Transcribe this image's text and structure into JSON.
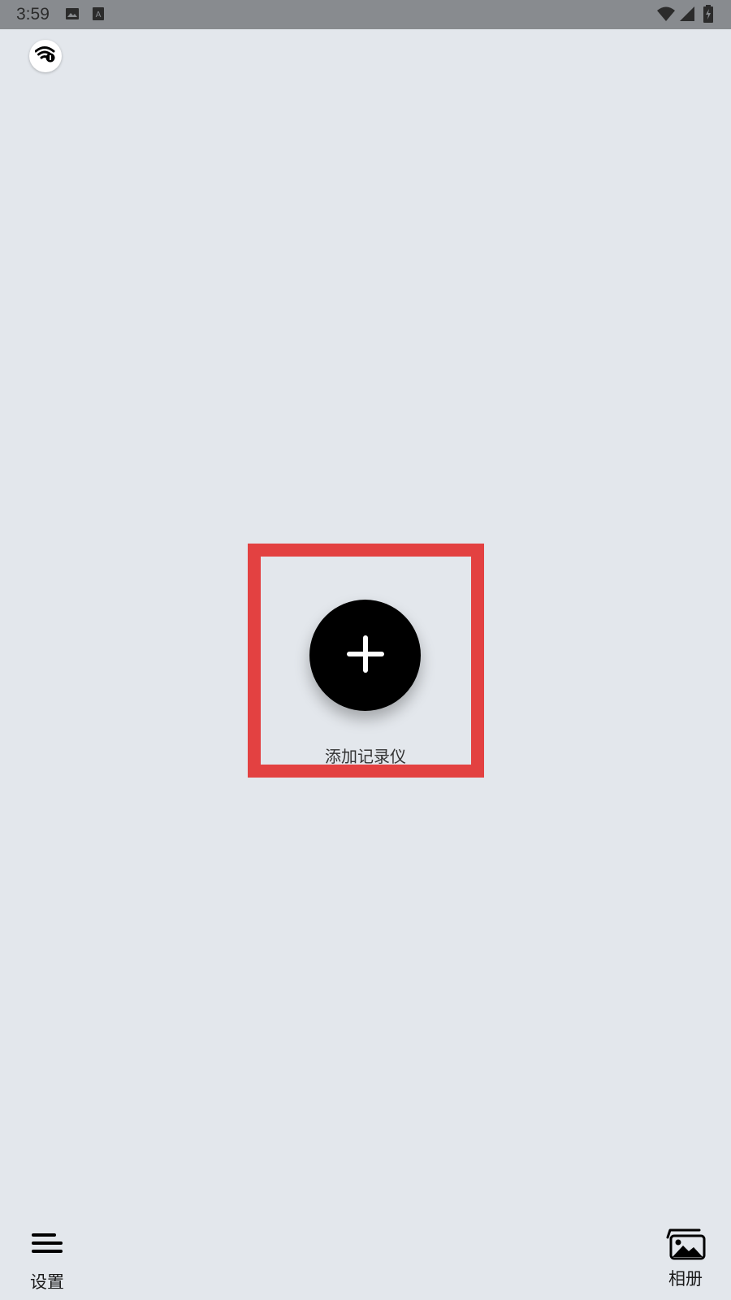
{
  "status_bar": {
    "time": "3:59",
    "icons": [
      "image-notification-icon",
      "a-notification-icon",
      "wifi-icon",
      "cell-signal-icon",
      "battery-charging-icon"
    ]
  },
  "top": {
    "wifi_button_icon": "wifi-info-icon"
  },
  "main": {
    "add_button_icon": "plus-icon",
    "add_label": "添加记录仪",
    "highlight_color": "#e34141"
  },
  "bottom_bar": {
    "settings_label": "设置",
    "settings_icon": "menu-icon",
    "album_label": "相册",
    "album_icon": "gallery-icon"
  },
  "colors": {
    "background": "#e3e7ec",
    "status_bar": "#888b8f",
    "button": "#000000"
  }
}
